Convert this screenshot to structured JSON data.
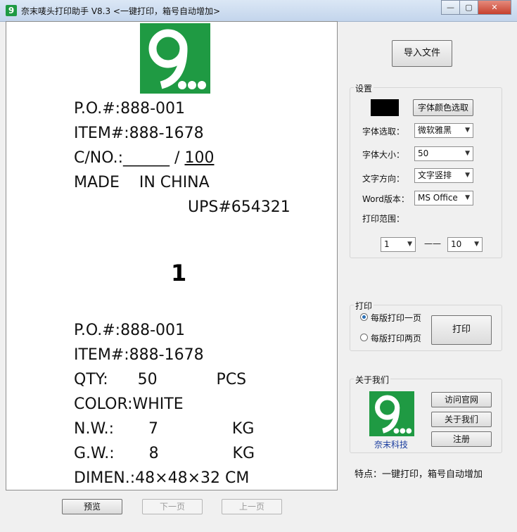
{
  "window": {
    "title": "奈末唛头打印助手 V8.3   <一键打印，箱号自动增加>",
    "icon_text": "9",
    "minimize": "—",
    "maximize": "▢",
    "close": "✕"
  },
  "preview": {
    "logo_text": "9",
    "lines_top": [
      "P.O.#:888-001",
      "ITEM#:888-1678"
    ],
    "cno_prefix": "C/NO.:______  / ",
    "cno_total": "100",
    "made_in": "MADE    IN CHINA",
    "ups": "UPS#654321",
    "box_number": "1",
    "lines_bottom": [
      "P.O.#:888-001",
      "ITEM#:888-1678",
      "QTY:      50            PCS",
      "COLOR:WHITE",
      "N.W.:       7               KG",
      "G.W.:       8               KG",
      "DIMEN.:48×48×32 CM"
    ]
  },
  "nav": {
    "preview_btn": "预览",
    "next_btn": "下一页",
    "prev_btn": "上一页"
  },
  "right": {
    "import_btn": "导入文件",
    "settings": {
      "title": "设置",
      "font_color_btn": "字体颜色选取",
      "font_color": "#000000",
      "font_label": "字体选取：",
      "font_value": "微软雅黑",
      "size_label": "字体大小：",
      "size_value": "50",
      "direction_label": "文字方向：",
      "direction_value": "文字竖排",
      "word_label": "Word版本：",
      "word_value": "MS Office",
      "range_label": "打印范围：",
      "range_from": "1",
      "range_dash": "——",
      "range_to": "10"
    },
    "print": {
      "title": "打印",
      "option1": "每版打印一页",
      "option2": "每版打印两页",
      "selected": "option1",
      "print_btn": "打印"
    },
    "about": {
      "title": "关于我们",
      "logo_text": "9",
      "company": "奈末科技",
      "visit_btn": "访问官网",
      "about_btn": "关于我们",
      "register_btn": "注册"
    },
    "feature": "特点：一键打印，箱号自动增加"
  },
  "colors": {
    "brand_green": "#1f9a43"
  }
}
